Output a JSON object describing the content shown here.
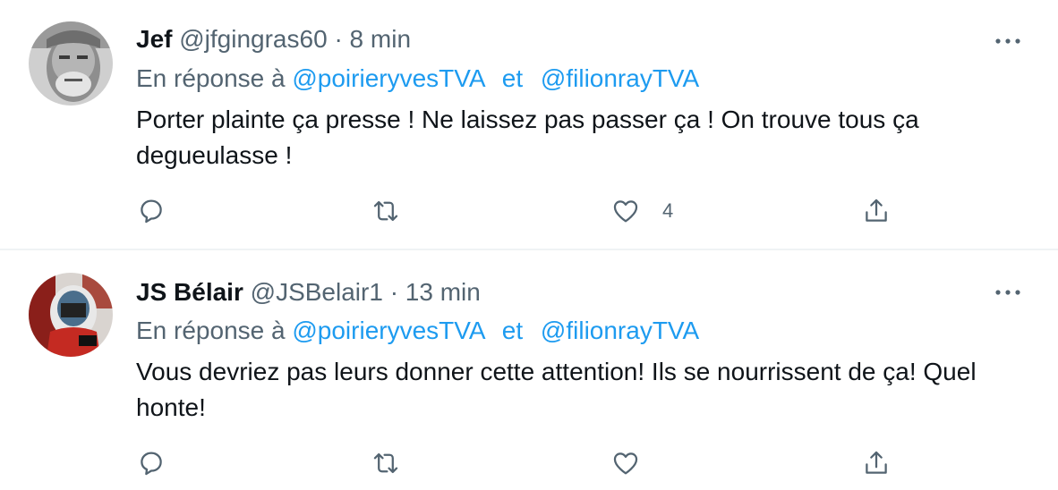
{
  "tweets": [
    {
      "name": "Jef",
      "handle": "@jfgingras60",
      "separator": "·",
      "time": "8 min",
      "reply_prefix": "En réponse à",
      "mention1": "@poirieryvesTVA",
      "conjunction": "et",
      "mention2": "@filionrayTVA",
      "text": "Porter plainte ça presse ! Ne laissez pas passer ça !  On trouve tous ça degueulasse !",
      "like_count": "4"
    },
    {
      "name": "JS Bélair",
      "handle": "@JSBelair1",
      "separator": "·",
      "time": "13 min",
      "reply_prefix": "En réponse à",
      "mention1": "@poirieryvesTVA",
      "conjunction": "et",
      "mention2": "@filionrayTVA",
      "text": "Vous devriez pas leurs donner cette attention! Ils se nourrissent de ça! Quel honte!",
      "like_count": ""
    }
  ],
  "icons": {
    "reply": "speech-bubble-icon",
    "retweet": "retweet-arrows-icon",
    "like": "heart-icon",
    "share": "share-upload-icon",
    "more": "more-dots-icon"
  },
  "colors": {
    "text": "#0f1419",
    "secondary": "#536471",
    "link": "#1d9bf0",
    "divider": "#eff3f4"
  }
}
